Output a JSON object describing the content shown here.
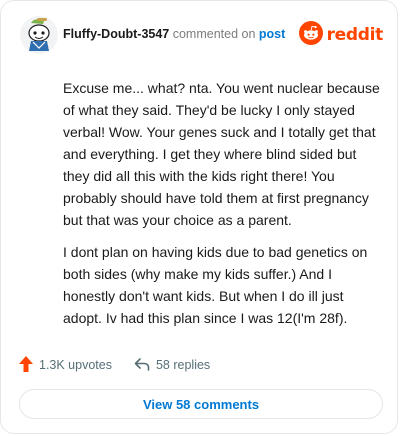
{
  "header": {
    "username": "Fluffy-Doubt-3547",
    "action": "commented on",
    "link": "post",
    "brand": "reddit"
  },
  "comment": {
    "paragraphs": [
      "Excuse me... what? nta. You went nuclear because of what they said. They'd be lucky I only stayed verbal! Wow. Your genes suck and I totally get that and everything. I get they where blind sided but they did all this with the kids right there! You probably should have told them at first pregnancy but that was your choice as a parent.",
      "I dont plan on having kids due to bad genetics on both sides (why make my kids suffer.) And I honestly don't want kids. But when I do ill just adopt. Iv had this plan since I was 12(I'm 28f)."
    ]
  },
  "actions": {
    "upvotes": "1.3K upvotes",
    "replies": "58 replies"
  },
  "footer": {
    "view_label": "View 58 comments"
  },
  "colors": {
    "brand": "#ff4500",
    "link": "#0079d3",
    "muted": "#576f76"
  },
  "icons": [
    "snoo-avatar-icon",
    "reddit-logo-icon",
    "upvote-arrow-icon",
    "reply-arrow-icon"
  ]
}
